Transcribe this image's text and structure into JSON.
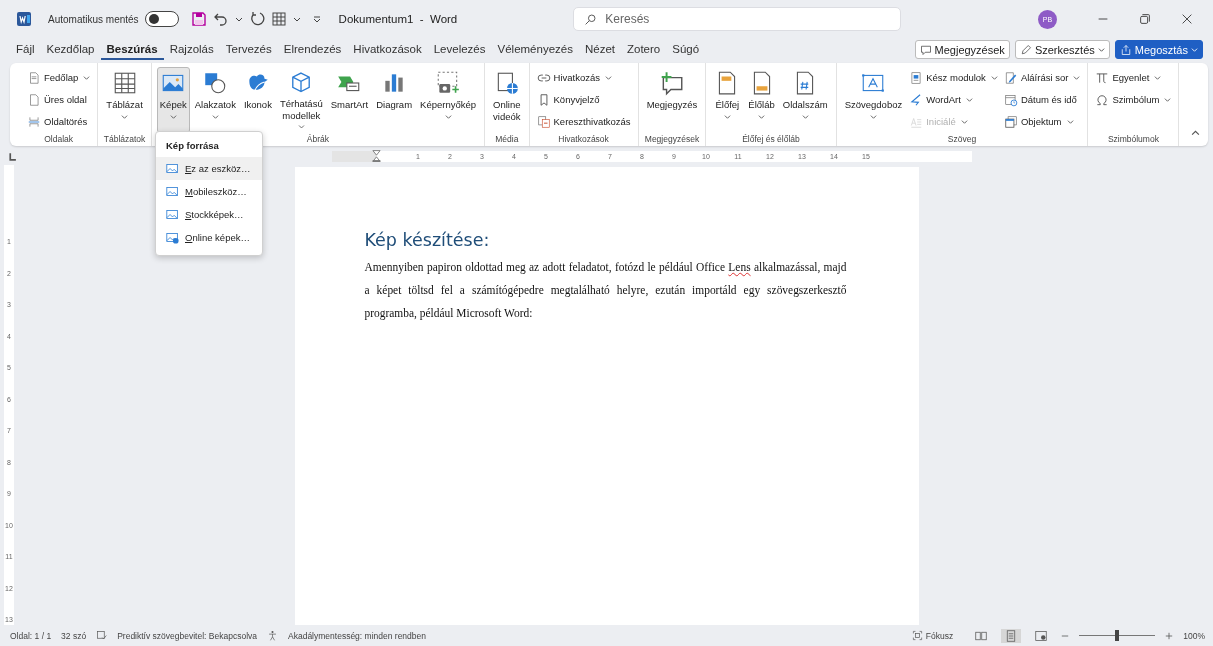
{
  "title_bar": {
    "autosave_label": "Automatikus mentés",
    "autosave_on": false,
    "document_title": "Dokumentum1  -  Word",
    "search": {
      "placeholder": "Keresés"
    },
    "avatar": "PB"
  },
  "menu_tabs": [
    {
      "label": "Fájl",
      "selected": false
    },
    {
      "label": "Kezdőlap",
      "selected": false
    },
    {
      "label": "Beszúrás",
      "selected": true
    },
    {
      "label": "Rajzolás",
      "selected": false
    },
    {
      "label": "Tervezés",
      "selected": false
    },
    {
      "label": "Elrendezés",
      "selected": false
    },
    {
      "label": "Hivatkozások",
      "selected": false
    },
    {
      "label": "Levelezés",
      "selected": false
    },
    {
      "label": "Véleményezés",
      "selected": false
    },
    {
      "label": "Nézet",
      "selected": false
    },
    {
      "label": "Zotero",
      "selected": false
    },
    {
      "label": "Súgó",
      "selected": false
    }
  ],
  "header_buttons": [
    {
      "label": "Megjegyzések",
      "kind": "comments"
    },
    {
      "label": "Szerkesztés",
      "kind": "editing"
    },
    {
      "label": "Megosztás",
      "kind": "share"
    }
  ],
  "ribbon": {
    "groups": [
      {
        "label": "Oldalak",
        "items": [
          {
            "kind": "stack",
            "items": [
              {
                "label": "Fedőlap",
                "dropdown": true,
                "disabled": false
              },
              {
                "label": "Üres oldal",
                "dropdown": false,
                "disabled": false
              },
              {
                "label": "Oldaltörés",
                "dropdown": false,
                "disabled": false
              }
            ]
          }
        ]
      },
      {
        "label": "Táblázatok",
        "items": [
          {
            "kind": "large",
            "label": "Táblázat",
            "dropdown": true,
            "pressed": false
          }
        ]
      },
      {
        "label": "Ábrák",
        "items": [
          {
            "kind": "large",
            "label": "Képek",
            "dropdown": true,
            "pressed": true
          },
          {
            "kind": "large",
            "label": "Alakzatok",
            "dropdown": true,
            "pressed": false
          },
          {
            "kind": "large",
            "label": "Ikonok",
            "dropdown": false,
            "pressed": false
          },
          {
            "kind": "large",
            "label": "Térhatású\nmodellek",
            "dropdown": true,
            "pressed": false
          },
          {
            "kind": "large",
            "label": "SmartArt",
            "dropdown": false,
            "pressed": false
          },
          {
            "kind": "large",
            "label": "Diagram",
            "dropdown": false,
            "pressed": false
          },
          {
            "kind": "large",
            "label": "Képernyőkép",
            "dropdown": true,
            "pressed": false
          }
        ]
      },
      {
        "label": "Média",
        "items": [
          {
            "kind": "large",
            "label": "Online\nvideók",
            "dropdown": false,
            "pressed": false
          }
        ]
      },
      {
        "label": "Hivatkozások",
        "items": [
          {
            "kind": "stack",
            "items": [
              {
                "label": "Hivatkozás",
                "dropdown": true,
                "disabled": false
              },
              {
                "label": "Könyvjelző",
                "dropdown": false,
                "disabled": false
              },
              {
                "label": "Kereszthivatkozás",
                "dropdown": false,
                "disabled": false
              }
            ]
          }
        ]
      },
      {
        "label": "Megjegyzések",
        "items": [
          {
            "kind": "large",
            "label": "Megjegyzés",
            "dropdown": false,
            "pressed": false
          }
        ]
      },
      {
        "label": "Élőfej és élőláb",
        "items": [
          {
            "kind": "large",
            "label": "Élőfej",
            "dropdown": true,
            "pressed": false
          },
          {
            "kind": "large",
            "label": "Élőláb",
            "dropdown": true,
            "pressed": false
          },
          {
            "kind": "large",
            "label": "Oldalszám",
            "dropdown": true,
            "pressed": false
          }
        ]
      },
      {
        "label": "Szöveg",
        "items": [
          {
            "kind": "large",
            "label": "Szövegdoboz",
            "dropdown": true,
            "pressed": false
          },
          {
            "kind": "stack",
            "items": [
              {
                "label": "Kész modulok",
                "dropdown": true,
                "disabled": false
              },
              {
                "label": "WordArt",
                "dropdown": true,
                "disabled": false
              },
              {
                "label": "Iniciálé",
                "dropdown": true,
                "disabled": true
              }
            ]
          },
          {
            "kind": "stack",
            "items": [
              {
                "label": "Aláírási sor",
                "dropdown": true,
                "disabled": false
              },
              {
                "label": "Dátum és idő",
                "dropdown": false,
                "disabled": false
              },
              {
                "label": "Objektum",
                "dropdown": true,
                "disabled": false
              }
            ]
          }
        ]
      },
      {
        "label": "Szimbólumok",
        "items": [
          {
            "kind": "stack",
            "items": [
              {
                "label": "Egyenlet",
                "dropdown": true,
                "disabled": false
              },
              {
                "label": "Szimbólum",
                "dropdown": true,
                "disabled": false
              }
            ]
          }
        ]
      }
    ]
  },
  "picture_menu": {
    "title": "Kép forrása",
    "items": [
      {
        "label": "Ez az eszköz…",
        "selected": true
      },
      {
        "label": "Mobileszköz…",
        "selected": false
      },
      {
        "label": "Stockképek…",
        "selected": false
      },
      {
        "label": "Online képek…",
        "selected": false
      }
    ]
  },
  "ruler": {
    "horizontal": [
      "1",
      "2",
      "3",
      "4",
      "5",
      "6",
      "7",
      "8",
      "9",
      "10",
      "11",
      "12",
      "13",
      "14",
      "15"
    ],
    "vertical": [
      "1",
      "2",
      "3",
      "4",
      "5",
      "6",
      "7",
      "8",
      "9",
      "10",
      "11",
      "12",
      "13"
    ]
  },
  "document": {
    "heading": "Kép készítése:",
    "paragraph": [
      {
        "text": "Amennyiben papiron oldottad meg az adott feladatot, fotózd le például Office ",
        "misspelled": false
      },
      {
        "text": "Lens",
        "misspelled": true
      },
      {
        "text": " alkalmazással, majd a képet töltsd fel a számítógépedre megtalálható helyre, ezután importáld egy szövegszerkesztő programba, például Microsoft Word:",
        "misspelled": false
      }
    ]
  },
  "status_bar": {
    "page": "Oldal: 1 / 1",
    "words": "32 szó",
    "predictive": "Prediktív szövegbevitel: Bekapcsolva",
    "accessibility": "Akadálymentesség: minden rendben",
    "focus": "Fókusz",
    "views": [
      {
        "selected": false
      },
      {
        "selected": true
      },
      {
        "selected": false
      }
    ],
    "zoom": {
      "level": 0.5,
      "reading": "100%"
    }
  }
}
